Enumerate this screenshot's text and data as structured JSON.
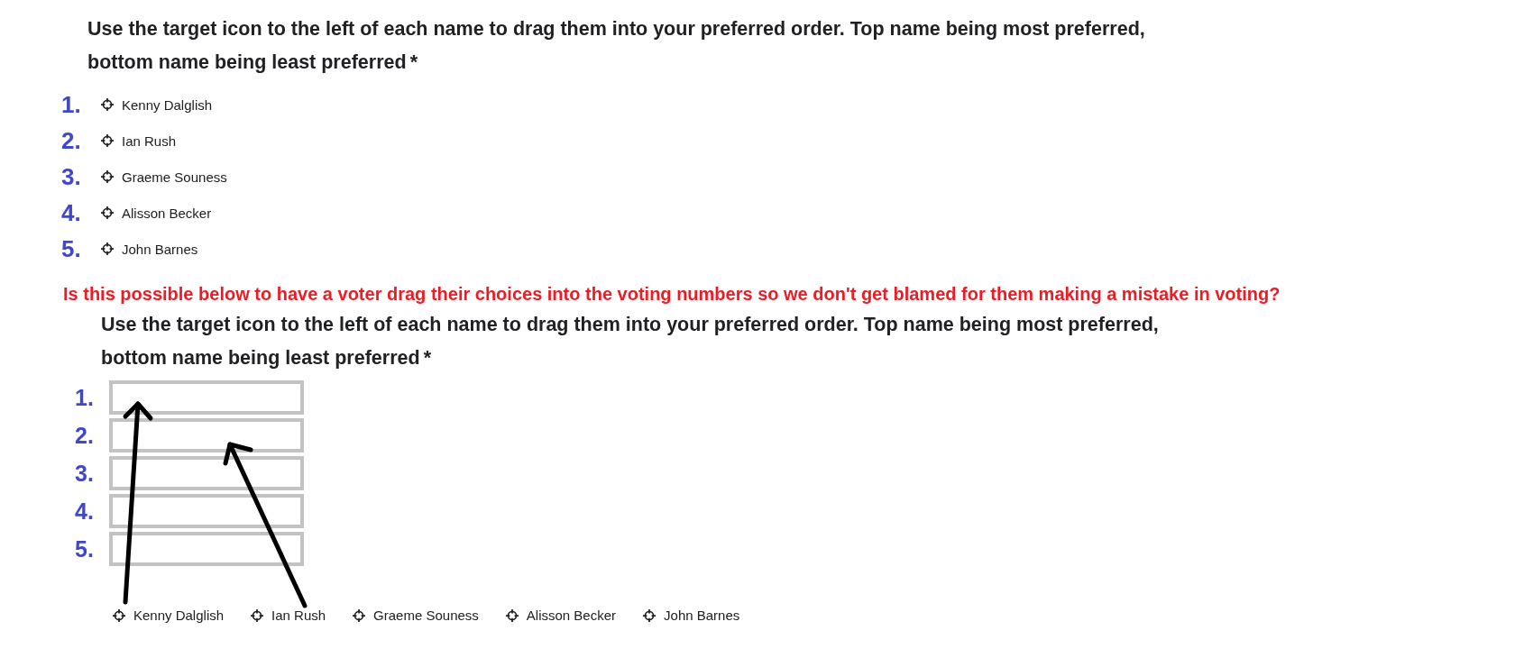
{
  "question": {
    "text": "Use the target icon to the left of each name to drag them into your preferred order. Top name being most preferred, bottom name being least preferred",
    "required_mark": "*"
  },
  "ranked_list": [
    {
      "number": "1.",
      "name": "Kenny Dalglish"
    },
    {
      "number": "2.",
      "name": "Ian Rush"
    },
    {
      "number": "3.",
      "name": "Graeme Souness"
    },
    {
      "number": "4.",
      "name": "Alisson Becker"
    },
    {
      "number": "5.",
      "name": "John Barnes"
    }
  ],
  "annotation": "Is this possible below to have a voter drag their choices into the voting numbers so we don't get blamed for them making a mistake in voting?",
  "mockup": {
    "question": {
      "text": "Use the target icon to the left of each name to drag them into your preferred order. Top name being most preferred, bottom name being least preferred",
      "required_mark": "*"
    },
    "slots": [
      {
        "number": "1."
      },
      {
        "number": "2."
      },
      {
        "number": "3."
      },
      {
        "number": "4."
      },
      {
        "number": "5."
      }
    ],
    "choices": [
      "Kenny Dalglish",
      "Ian Rush",
      "Graeme Souness",
      "Alisson Becker",
      "John Barnes"
    ]
  }
}
